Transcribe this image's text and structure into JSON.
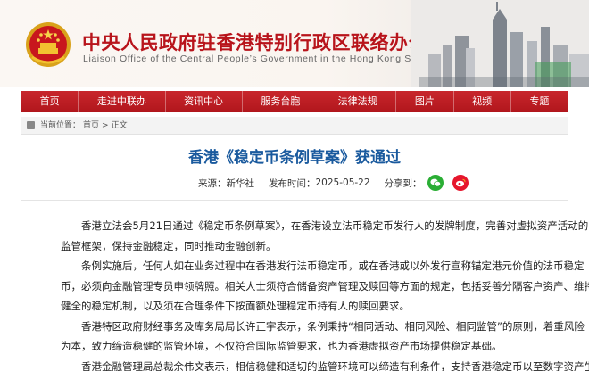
{
  "header": {
    "title": "中央人民政府驻香港特别行政区联络办公室",
    "subtitle": "Liaison Office of the Central People’s Government in the Hong Kong S.A.R."
  },
  "nav": {
    "items": [
      "首页",
      "走进中联办",
      "资讯中心",
      "服务台胞",
      "法律法规",
      "图片",
      "视频",
      "专题"
    ]
  },
  "breadcrumb": {
    "label": "当前位置：",
    "home": "首页",
    "sep": ">",
    "current": "正文"
  },
  "article": {
    "title": "香港《稳定币条例草案》获通过",
    "source_label": "来源：",
    "source": "新华社",
    "date_label": "发布时间：",
    "date": "2025-05-22",
    "share_label": "分享到：",
    "paragraphs": [
      [
        "香港立法会5月21日通过《稳定币条例草案》，在香港设立法币稳定币发行人的发牌制度，完善对虚拟资产活动的",
        "监管框架，保持金融稳定，同时推动金融创新。"
      ],
      [
        "条例实施后，任何人如在业务过程中在香港发行法币稳定币，或在香港或以外发行宣称锚定港元价值的法币稳定",
        "币，必须向金融管理专员申领牌照。相关人士须符合储备资产管理及赎回等方面的规定，包括妥善分隔客户资产、维持",
        "健全的稳定机制，以及须在合理条件下按面额处理稳定币持有人的赎回要求。"
      ],
      [
        "香港特区政府财经事务及库务局局长许正宇表示，条例秉持“相同活动、相同风险、相同监管”的原则，着重风险",
        "为本，致力缔造稳健的监管环境，不仅符合国际监管要求，也为香港虚拟资产市场提供稳定基础。"
      ],
      [
        "香港金融管理局总裁余伟文表示，相信稳健和适切的监管环境可以缔造有利条件，支持香港稳定币以至数字资产生"
      ]
    ]
  },
  "colors": {
    "brand_red": "#b8141b",
    "nav_red": "#c8262c",
    "title_blue": "#1a5a9e",
    "wechat_green": "#2aae34",
    "weibo_red": "#e6162d"
  },
  "icons": {
    "emblem": "national-emblem-icon",
    "breadcrumb": "location-icon",
    "wechat": "wechat-icon",
    "weibo": "weibo-icon"
  }
}
